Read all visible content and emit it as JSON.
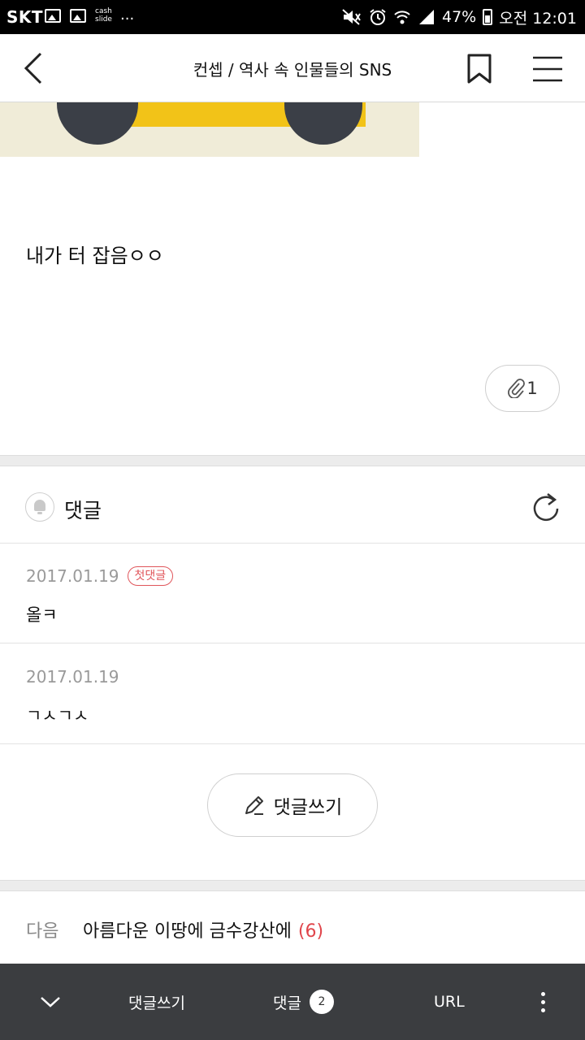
{
  "status_bar": {
    "carrier": "SKT",
    "cash_line1": "cash",
    "cash_line2": "slide",
    "more": "...",
    "battery": "47%",
    "time": "오전 12:01"
  },
  "header": {
    "title": "컨셉 / 역사 속 인물들의 SNS"
  },
  "article": {
    "body_text": "내가 터 잡음ㅇㅇ",
    "attachment_count": "1"
  },
  "comments": {
    "title": "댓글",
    "items": [
      {
        "date": "2017.01.19",
        "badge": "첫댓글",
        "text": "올ㅋ"
      },
      {
        "date": "2017.01.19",
        "badge": "",
        "text": "ㄱㅅㄱㅅ"
      }
    ],
    "write_label": "댓글쓰기"
  },
  "next": {
    "label": "다음",
    "title": "아름다운 이땅에 금수강산에",
    "count": "(6)"
  },
  "bottom_bar": {
    "write_label": "댓글쓰기",
    "comments_label": "댓글",
    "comments_count": "2",
    "url_label": "URL"
  },
  "colors": {
    "accent_red": "#e0454b",
    "bottom_bar_bg": "#3b3d40"
  }
}
